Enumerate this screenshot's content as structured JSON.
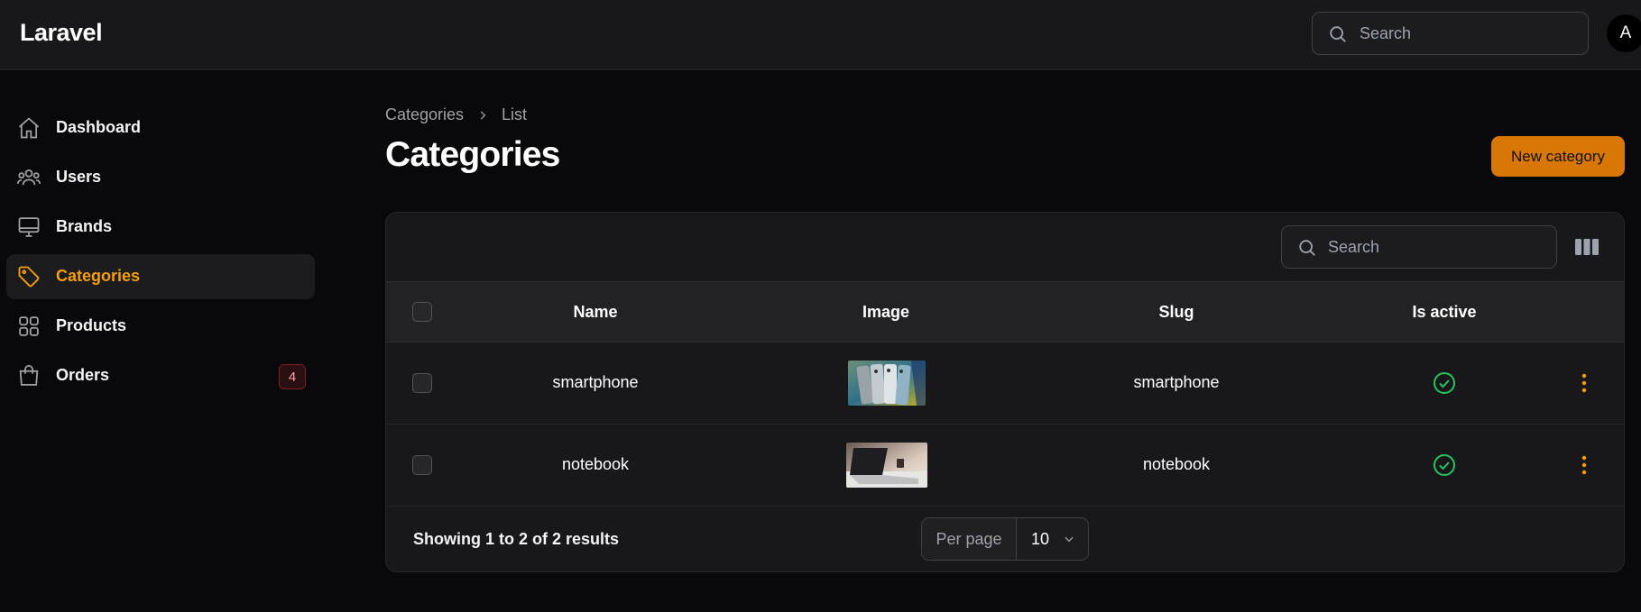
{
  "app": {
    "brand": "Laravel",
    "avatar_initial": "A"
  },
  "topbar": {
    "search_placeholder": "Search",
    "search_icon": "search-icon"
  },
  "sidebar": {
    "items": [
      {
        "label": "Dashboard",
        "icon": "home-icon",
        "active": false
      },
      {
        "label": "Users",
        "icon": "users-icon",
        "active": false
      },
      {
        "label": "Brands",
        "icon": "monitor-icon",
        "active": false
      },
      {
        "label": "Categories",
        "icon": "tag-icon",
        "active": true
      },
      {
        "label": "Products",
        "icon": "grid-icon",
        "active": false
      },
      {
        "label": "Orders",
        "icon": "shopping-bag-icon",
        "active": false,
        "badge": "4"
      }
    ]
  },
  "breadcrumb": {
    "parent": "Categories",
    "current": "List"
  },
  "page": {
    "title": "Categories",
    "new_button": "New category"
  },
  "table": {
    "search_placeholder": "Search",
    "columns": [
      "Name",
      "Image",
      "Slug",
      "Is active"
    ],
    "rows": [
      {
        "name": "smartphone",
        "image": "smartphone-photo",
        "slug": "smartphone",
        "is_active": true
      },
      {
        "name": "notebook",
        "image": "notebook-photo",
        "slug": "notebook",
        "is_active": true
      }
    ],
    "summary": "Showing 1 to 2 of 2 results",
    "per_page_label": "Per page",
    "per_page_value": "10"
  },
  "colors": {
    "accent": "#f59e0b",
    "button": "#d97706",
    "success": "#22c55e",
    "background": "#09090b",
    "surface": "#18181b"
  }
}
